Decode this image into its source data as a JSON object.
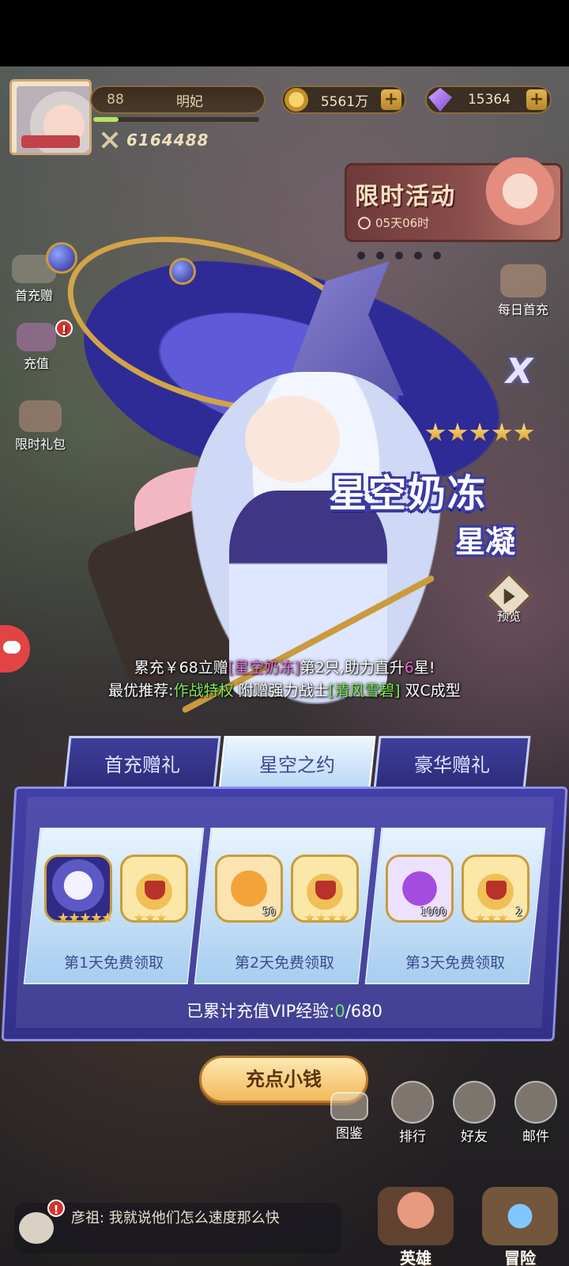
{
  "player": {
    "level": "88",
    "name": "明妃",
    "power": "6164488",
    "exp_fraction": 0.15
  },
  "currency": {
    "gold": "5561万",
    "gems": "15364",
    "plus": "+"
  },
  "event": {
    "title": "限时活动",
    "timer": "05天06时"
  },
  "side_buttons": {
    "first_charge": "首充赠",
    "recharge": "充值",
    "limited_pack": "限时礼包",
    "daily_first": "每日首充",
    "badge": "!"
  },
  "hero": {
    "name": "星空奶冻",
    "title": "星凝",
    "stars": 5,
    "preview_label": "预览"
  },
  "promo": {
    "line1_a": "累充￥68立赠",
    "line1_pink": "[星空奶冻]",
    "line1_b": "第2只,助力直升",
    "line1_pink2": "6",
    "line1_c": "星!",
    "line2_a": "最优推荐:",
    "line2_green": "作战特权",
    "line2_b": "附赠强力战士",
    "line2_green2": "[清风雪碧]",
    "line2_c": "双C成型"
  },
  "tabs": [
    {
      "label": "首充赠礼",
      "active": false
    },
    {
      "label": "星空之约",
      "active": true
    },
    {
      "label": "豪华赠礼",
      "active": false
    }
  ],
  "days": [
    {
      "label": "第1天免费领取",
      "items": [
        {
          "icon": "hero-portrait",
          "qty": ""
        },
        {
          "icon": "treasure-chest",
          "qty": ""
        }
      ]
    },
    {
      "label": "第2天免费领取",
      "items": [
        {
          "icon": "gold-medal",
          "qty": "50"
        },
        {
          "icon": "treasure-chest",
          "qty": ""
        }
      ]
    },
    {
      "label": "第3天免费领取",
      "items": [
        {
          "icon": "purple-crystal",
          "qty": "1000"
        },
        {
          "icon": "treasure-chest",
          "qty": "2"
        }
      ]
    }
  ],
  "vip": {
    "prefix": "已累计充值VIP经验:",
    "current": "0",
    "suffix": "/680"
  },
  "charge_button": "充点小钱",
  "bottom_menu": {
    "handbook": "图鉴",
    "ranking": "排行",
    "friends": "好友",
    "mail": "邮件"
  },
  "chat": {
    "message": "彦祖: 我就说他们怎么速度那么快"
  },
  "nav": {
    "heroes": "英雄",
    "adventure": "冒险"
  }
}
